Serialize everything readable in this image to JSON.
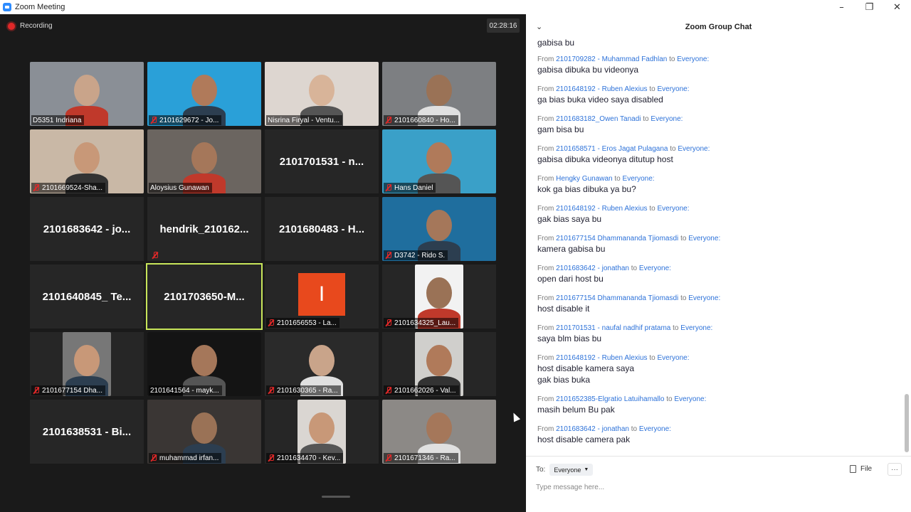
{
  "window": {
    "title": "Zoom Meeting"
  },
  "recording": {
    "label": "Recording"
  },
  "timer": "02:28:16",
  "tiles": [
    {
      "label": "D5351 Indriana",
      "muted": false
    },
    {
      "label": "2101629672 - Jo...",
      "muted": true
    },
    {
      "label": "Nisrina Firyal - Ventu...",
      "muted": false
    },
    {
      "label": "2101660840 - Ho...",
      "muted": true
    },
    {
      "label": "2101669524-Sha...",
      "muted": true
    },
    {
      "label": "Aloysius Gunawan",
      "muted": false
    },
    {
      "big_name": "2101701531 - n..."
    },
    {
      "label": "Hans Daniel",
      "muted": true
    },
    {
      "big_name": "2101683642 - jo..."
    },
    {
      "big_name": "hendrik_210162...",
      "muted": true
    },
    {
      "big_name": "2101680483 - H..."
    },
    {
      "label": "D3742 - Rido S.",
      "muted": true
    },
    {
      "big_name": "2101640845_ Te..."
    },
    {
      "big_name": "2101703650-M...",
      "active": true
    },
    {
      "label": "2101656553 - La...",
      "muted": true,
      "avatar_letter": "I"
    },
    {
      "label": "2101634325_Lau...",
      "muted": true
    },
    {
      "label": "2101677154 Dha...",
      "muted": true
    },
    {
      "label": "2101641564 - mayk...",
      "muted": false
    },
    {
      "label": "2101630365 - Ra...",
      "muted": true
    },
    {
      "label": "2101662026 - Val...",
      "muted": true
    },
    {
      "big_name": "2101638531 - Bi..."
    },
    {
      "label": "muhammad irfan...",
      "muted": true
    },
    {
      "label": "2101634470 - Kev...",
      "muted": true
    },
    {
      "label": "2101671346 - Ra...",
      "muted": true
    }
  ],
  "chat": {
    "title": "Zoom Group Chat",
    "partial_top": "gabisa bu",
    "messages": [
      {
        "from": "2101709282 - Muhammad Fadhlan",
        "to": "Everyone",
        "lines": [
          "gabisa dibuka bu videonya"
        ]
      },
      {
        "from": "2101648192 - Ruben Alexius",
        "to": "Everyone",
        "lines": [
          "ga bias buka video saya disabled"
        ]
      },
      {
        "from": "2101683182_Owen Tanadi",
        "to": "Everyone",
        "lines": [
          "gam bisa bu"
        ]
      },
      {
        "from": "2101658571 - Eros Jagat Pulagana",
        "to": "Everyone",
        "lines": [
          "gabisa dibuka videonya ditutup host"
        ]
      },
      {
        "from": "Hengky Gunawan",
        "to": "Everyone",
        "lines": [
          "kok ga bias dibuka ya bu?"
        ]
      },
      {
        "from": "2101648192 - Ruben Alexius",
        "to": "Everyone",
        "lines": [
          "gak bias saya bu"
        ]
      },
      {
        "from": "2101677154 Dhammananda Tjiomasdi",
        "to": "Everyone",
        "lines": [
          "kamera gabisa bu"
        ]
      },
      {
        "from": "2101683642 - jonathan",
        "to": "Everyone",
        "lines": [
          "open dari host bu"
        ]
      },
      {
        "from": "2101677154 Dhammananda Tjiomasdi",
        "to": "Everyone",
        "lines": [
          "host disable it"
        ]
      },
      {
        "from": "2101701531 - naufal nadhif pratama",
        "to": "Everyone",
        "lines": [
          "saya blm bias bu"
        ]
      },
      {
        "from": "2101648192 - Ruben Alexius",
        "to": "Everyone",
        "lines": [
          "host disable kamera saya",
          "gak bias buka"
        ]
      },
      {
        "from": "2101652385-Elgratio Latuihamallo",
        "to": "Everyone",
        "lines": [
          "masih belum Bu pak"
        ]
      },
      {
        "from": "2101683642 - jonathan",
        "to": "Everyone",
        "lines": [
          "host disable camera pak"
        ]
      }
    ],
    "from_word": "From",
    "to_word": "to",
    "to_label": "To:",
    "to_value": "Everyone",
    "file_label": "File",
    "input_placeholder": "Type message here..."
  },
  "colors": {
    "accent": "#2d8cff",
    "record": "#e02828",
    "active_speaker": "#c8e65a",
    "link": "#2d72d9"
  }
}
